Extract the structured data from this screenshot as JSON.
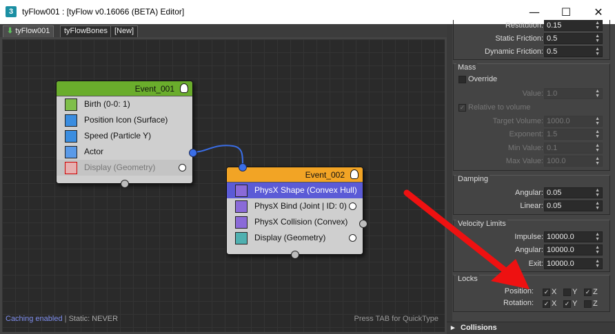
{
  "window": {
    "app_icon_label": "3",
    "title": "tyFlow001 : [tyFlow v0.16066 (BETA) Editor]",
    "minimize_glyph": "—",
    "maximize_glyph": "☐",
    "close_glyph": "✕"
  },
  "tabs": [
    {
      "label": "tyFlow001",
      "active": true,
      "icon": "green-down-arrow-icon"
    },
    {
      "label": "tyFlowBones"
    },
    {
      "label": "[New]"
    }
  ],
  "status": {
    "caching": "Caching enabled",
    "separator": "|",
    "static": "Static: NEVER",
    "hint": "Press TAB for QuickType"
  },
  "nodes": [
    {
      "title": "Event_001",
      "header_color": "#6aad2c",
      "operators": [
        {
          "label": "Birth (0-0: 1)",
          "icon": "birth-icon"
        },
        {
          "label": "Position Icon (Surface)",
          "icon": "position-icon"
        },
        {
          "label": "Speed (Particle Y)",
          "icon": "speed-icon"
        },
        {
          "label": "Actor",
          "icon": "actor-icon"
        },
        {
          "label": "Display (Geometry)",
          "icon": "display-disabled-icon",
          "disabled": true
        }
      ]
    },
    {
      "title": "Event_002",
      "header_color": "#f2a425",
      "operators": [
        {
          "label": "PhysX Shape (Convex Hull)",
          "icon": "physx-shape-icon",
          "selected": true
        },
        {
          "label": "PhysX Bind (Joint | ID: 0)",
          "icon": "physx-bind-icon"
        },
        {
          "label": "PhysX Collision (Convex)",
          "icon": "physx-collision-icon"
        },
        {
          "label": "Display (Geometry)",
          "icon": "display-icon"
        }
      ]
    }
  ],
  "panel": {
    "friction": {
      "restitution_label": "Restitution:",
      "restitution_value": "0.15",
      "static_label": "Static Friction:",
      "static_value": "0.5",
      "dynamic_label": "Dynamic Friction:",
      "dynamic_value": "0.5"
    },
    "mass": {
      "title": "Mass",
      "override_label": "Override",
      "value_label": "Value:",
      "value_value": "1.0",
      "relative_label": "Relative to volume",
      "target_volume_label": "Target Volume:",
      "target_volume_value": "1000.0",
      "exponent_label": "Exponent:",
      "exponent_value": "1.5",
      "min_value_label": "Min Value:",
      "min_value_value": "0.1",
      "max_value_label": "Max Value:",
      "max_value_value": "100.0"
    },
    "damping": {
      "title": "Damping",
      "angular_label": "Angular:",
      "angular_value": "0.05",
      "linear_label": "Linear:",
      "linear_value": "0.05"
    },
    "velocity": {
      "title": "Velocity Limits",
      "impulse_label": "Impulse:",
      "impulse_value": "10000.0",
      "angular_label": "Angular:",
      "angular_value": "10000.0",
      "exit_label": "Exit:",
      "exit_value": "10000.0"
    },
    "locks": {
      "title": "Locks",
      "position_label": "Position:",
      "rotation_label": "Rotation:",
      "x": "X",
      "y": "Y",
      "z": "Z",
      "position": {
        "x": true,
        "y": false,
        "z": true
      },
      "rotation": {
        "x": true,
        "y": true,
        "z": false
      }
    },
    "collisions_label": "Collisions",
    "collisions_arrow": "▸"
  },
  "annotation_arrow_color": "#ee1111"
}
